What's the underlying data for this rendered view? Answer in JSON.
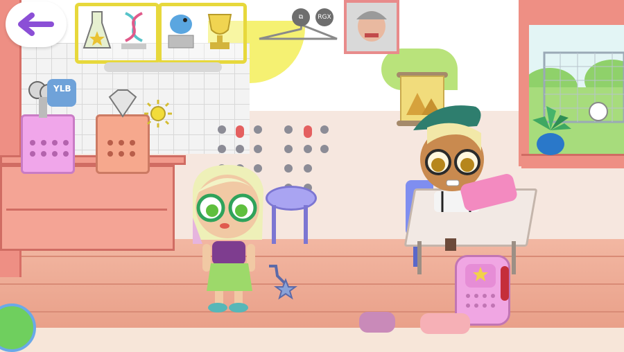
{
  "hud": {
    "back_icon": "arrow-left-icon",
    "share_icon": "share-icon",
    "rgx_label": "RGX"
  },
  "scene": {
    "shelf_items": [
      "flask-star-icon",
      "dna-icon",
      "bird-statue-icon",
      "trophy-icon"
    ],
    "basket_items": [
      "scissors-icon",
      "ylb-badge-icon",
      "diamond-icon",
      "sun-icon"
    ],
    "characters": [
      "blonde-girl-green-glasses",
      "boy-green-beret"
    ]
  },
  "colors": {
    "accent_purple": "#8b4fd6",
    "shelf_yellow": "#e7d83c",
    "wall_coral": "#ee8f84"
  }
}
